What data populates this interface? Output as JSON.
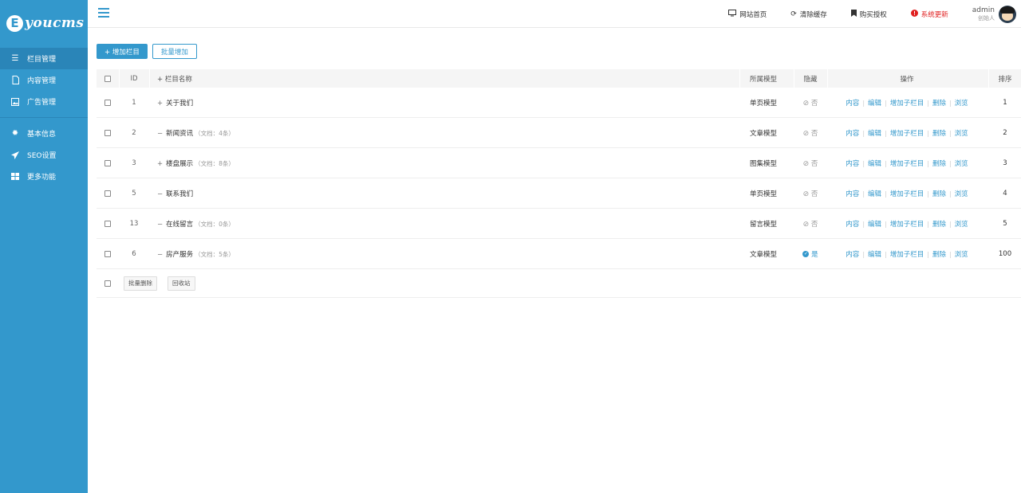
{
  "brand": {
    "badge_letter": "E",
    "text": "youcms",
    "color": "#3398cc"
  },
  "sidebar": {
    "items": [
      {
        "label": "栏目管理",
        "icon": "menu-lines-icon",
        "active": true
      },
      {
        "label": "内容管理",
        "icon": "document-icon"
      },
      {
        "label": "广告管理",
        "icon": "image-icon"
      },
      {
        "label": "基本信息",
        "icon": "gear-icon"
      },
      {
        "label": "SEO设置",
        "icon": "paper-plane-icon"
      },
      {
        "label": "更多功能",
        "icon": "grid-icon"
      }
    ]
  },
  "header": {
    "links": [
      {
        "label": "网站首页",
        "icon": "monitor-icon"
      },
      {
        "label": "清除缓存",
        "icon": "refresh-icon"
      },
      {
        "label": "购买授权",
        "icon": "bookmark-icon"
      },
      {
        "label": "系统更新",
        "icon": "alert-circle-icon",
        "color": "#e02020"
      }
    ],
    "user": {
      "name": "admin",
      "role": "创始人"
    }
  },
  "toolbar": {
    "add_label": "+ 增加栏目",
    "batch_add_label": "批量增加"
  },
  "table": {
    "headers": {
      "id": "ID",
      "name": "+ 栏目名称",
      "model": "所属模型",
      "hidden": "隐藏",
      "ops": "操作",
      "sort": "排序"
    },
    "rows": [
      {
        "id": "1",
        "sym": "+",
        "name": "关于我们",
        "count": "",
        "model": "单页模型",
        "hidden": "否",
        "sort": "1"
      },
      {
        "id": "2",
        "sym": "−",
        "name": "新闻资讯",
        "count": "（文档：4条）",
        "model": "文章模型",
        "hidden": "否",
        "sort": "2"
      },
      {
        "id": "3",
        "sym": "+",
        "name": "楼盘展示",
        "count": "（文档：8条）",
        "model": "图集模型",
        "hidden": "否",
        "sort": "3"
      },
      {
        "id": "5",
        "sym": "−",
        "name": "联系我们",
        "count": "",
        "model": "单页模型",
        "hidden": "否",
        "sort": "4"
      },
      {
        "id": "13",
        "sym": "−",
        "name": "在线留言",
        "count": "（文档：0条）",
        "model": "留言模型",
        "hidden": "否",
        "sort": "5"
      },
      {
        "id": "6",
        "sym": "−",
        "name": "房产服务",
        "count": "（文档：5条）",
        "model": "文章模型",
        "hidden": "是",
        "sort": "100"
      }
    ],
    "ops": [
      "内容",
      "编辑",
      "增加子栏目",
      "删除",
      "浏览"
    ]
  },
  "footer_actions": {
    "batch_delete": "批量删除",
    "recycle": "回收站"
  }
}
